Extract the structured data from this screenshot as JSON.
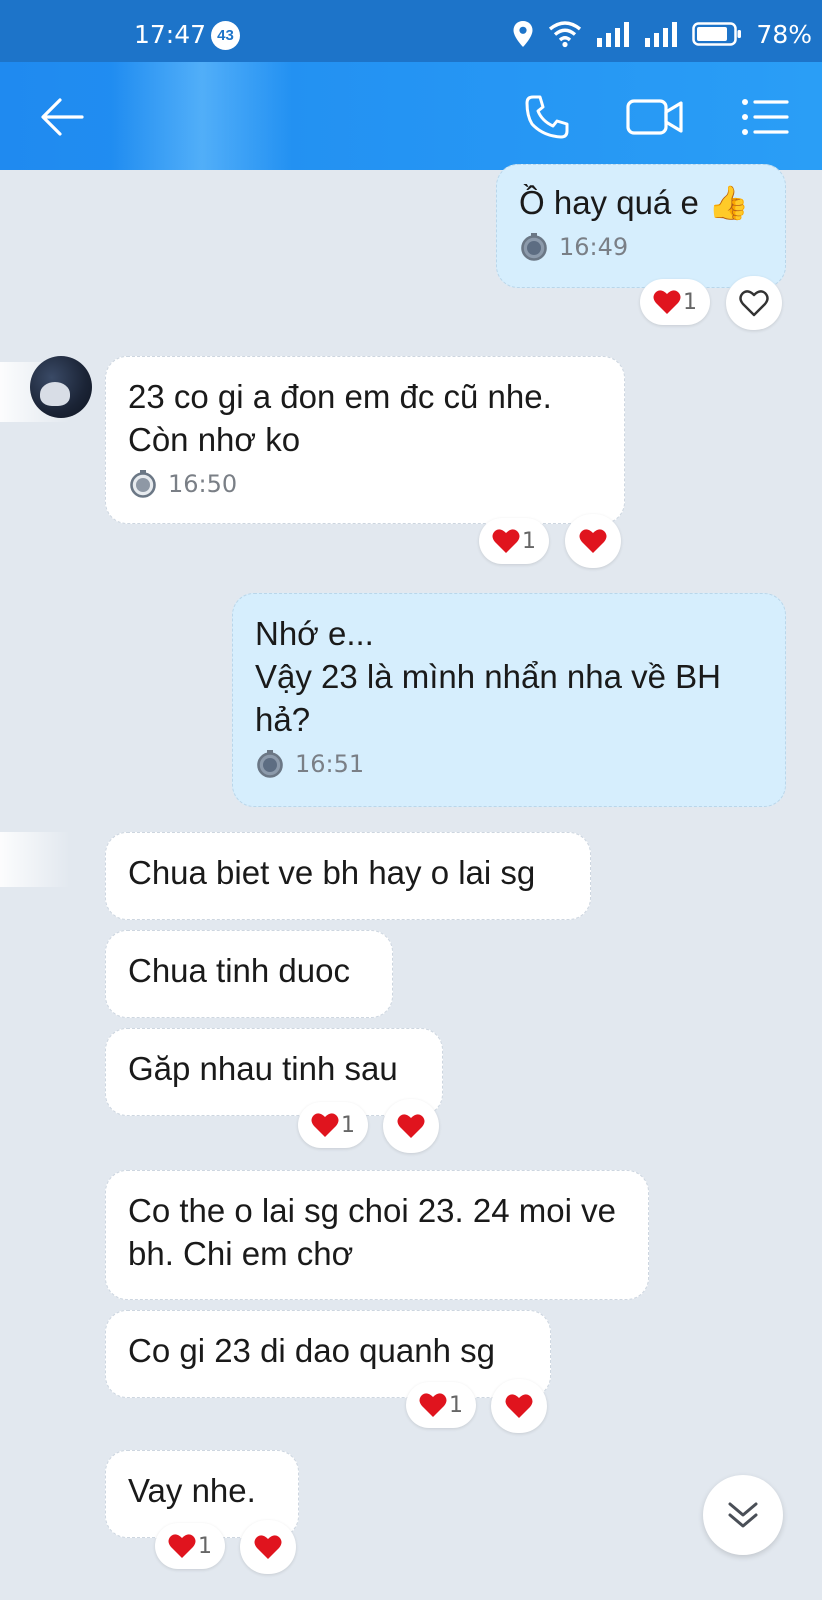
{
  "status_bar": {
    "time": "17:47",
    "notification_count": "43",
    "battery": "78%"
  },
  "header": {
    "back_icon": "arrow-left-icon",
    "call_icon": "phone-icon",
    "video_icon": "video-camera-icon",
    "menu_icon": "list-menu-icon"
  },
  "messages": [
    {
      "dir": "out",
      "text": "Ồ hay quá e 👍",
      "time": "16:49",
      "reaction_count": "1"
    },
    {
      "dir": "in",
      "text": "23 co gi a đon em đc cũ nhe.\nCòn nhơ ko",
      "time": "16:50",
      "reaction_count": "1"
    },
    {
      "dir": "out",
      "text": "Nhớ e...\nVậy 23 là mình nhẩn nha về BH hả?",
      "time": "16:51"
    },
    {
      "dir": "in",
      "text": "Chua biet ve bh hay o lai sg"
    },
    {
      "dir": "in",
      "text": "Chua tinh duoc"
    },
    {
      "dir": "in",
      "text": "Găp nhau tinh sau",
      "reaction_count": "1"
    },
    {
      "dir": "in",
      "text": "Co the o lai sg choi 23. 24 moi ve bh. Chi em chơ"
    },
    {
      "dir": "in",
      "text": "Co gi 23 di dao quanh sg",
      "reaction_count": "1"
    },
    {
      "dir": "in",
      "text": "Vay nhe.",
      "reaction_count": "1"
    }
  ],
  "colors": {
    "header": "#1f8af0",
    "status_bar": "#1d74c9",
    "outgoing_bubble": "#d6eefd",
    "incoming_bubble": "#ffffff",
    "heart": "#e0141e",
    "background": "#e2e8ef"
  }
}
